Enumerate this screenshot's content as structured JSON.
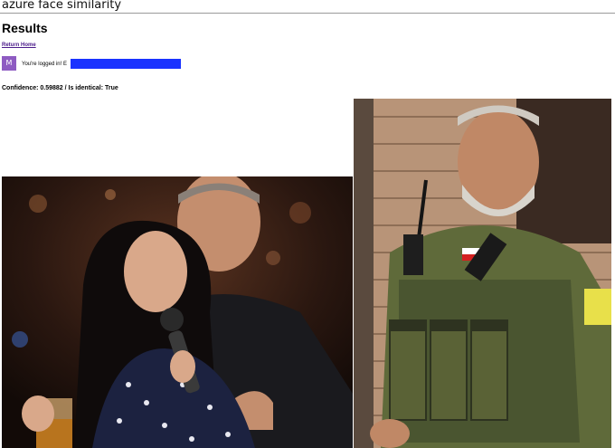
{
  "app": {
    "title": "azure face similarity"
  },
  "page": {
    "heading": "Results"
  },
  "nav": {
    "return_home": "Return Home"
  },
  "user": {
    "avatar_letter": "M",
    "login_text": "You're logged in! E",
    "email_redacted": true,
    "avatar_color": "#8e5bc2",
    "redaction_color": "#1a33ff"
  },
  "result": {
    "summary": "Confidence: 0.59882 / Is identical: True",
    "confidence": 0.59882,
    "is_identical": true
  },
  "images": [
    {
      "name": "comparison-photo-1"
    },
    {
      "name": "comparison-photo-2"
    }
  ]
}
